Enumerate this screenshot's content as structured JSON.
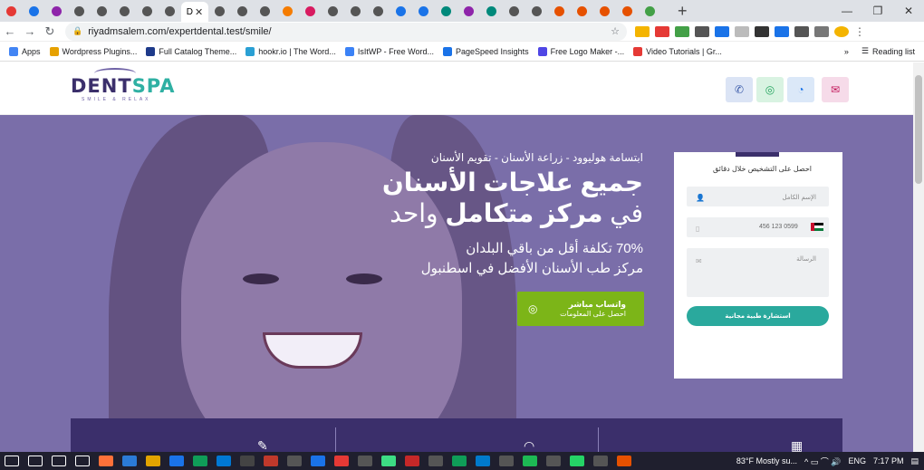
{
  "browser": {
    "active_tab_label": "D",
    "url": "riyadmsalem.com/expertdental.test/smile/",
    "reading_list": "Reading list",
    "bookmarks": [
      {
        "label": "Apps",
        "color": "#4285f4"
      },
      {
        "label": "Wordpress Plugins...",
        "color": "#e6a100"
      },
      {
        "label": "Full Catalog Theme...",
        "color": "#1e3a8a"
      },
      {
        "label": "hookr.io | The Word...",
        "color": "#2aa0d4"
      },
      {
        "label": "IsItWP - Free Word...",
        "color": "#3b82f6"
      },
      {
        "label": "PageSpeed Insights",
        "color": "#1a73e8"
      },
      {
        "label": "Free Logo Maker -...",
        "color": "#4f46e5"
      },
      {
        "label": "Video Tutorials | Gr...",
        "color": "#e53935"
      }
    ],
    "tab_colors": [
      "#e53935",
      "#1a73e8",
      "#8e24aa",
      "#555",
      "#555",
      "#555",
      "#555",
      "#555",
      "#555",
      "#555",
      "#555",
      "#f57c00",
      "#d81b60",
      "#555",
      "#555",
      "#555",
      "#1a73e8",
      "#1a73e8",
      "#00897b",
      "#8e24aa",
      "#00897b",
      "#555",
      "#555",
      "#e65100",
      "#e65100",
      "#e65100",
      "#e65100",
      "#43a047"
    ]
  },
  "header": {
    "logo_main": "DENT",
    "logo_accent": "SPA",
    "logo_tagline": "SMILE & RELAX"
  },
  "hero": {
    "subtitle": "ابتسامة هوليوود - زراعة الأسنان - تقويم الأسنان",
    "heading_line1": "جميع علاجات الأسنان",
    "heading_line2_prefix": "في",
    "heading_line2_bold": "مركز متكامل",
    "heading_line2_suffix": "واحد",
    "para_line1": "70% تكلفة أقل من باقي البلدان",
    "para_line2": "مركز طب الأسنان الأفضل في اسطنبول",
    "whatsapp_title": "واتساب مباشر",
    "whatsapp_sub": "احصل على المعلومات"
  },
  "form": {
    "title": "احصل على التشخيص خلال دقائق",
    "name_placeholder": "الإسم الكامل",
    "phone_placeholder": "456 123 0599",
    "message_placeholder": "الرسالة",
    "submit_label": "استشارة طبية مجانية"
  },
  "taskbar": {
    "weather": "83°F  Mostly su...",
    "lang": "ENG",
    "time": "7:17 PM"
  },
  "colors": {
    "brand_purple": "#3b2f6b",
    "teal": "#2aa99d",
    "whatsapp_green": "#7cb518",
    "hero_bg": "#7a6ea9"
  }
}
